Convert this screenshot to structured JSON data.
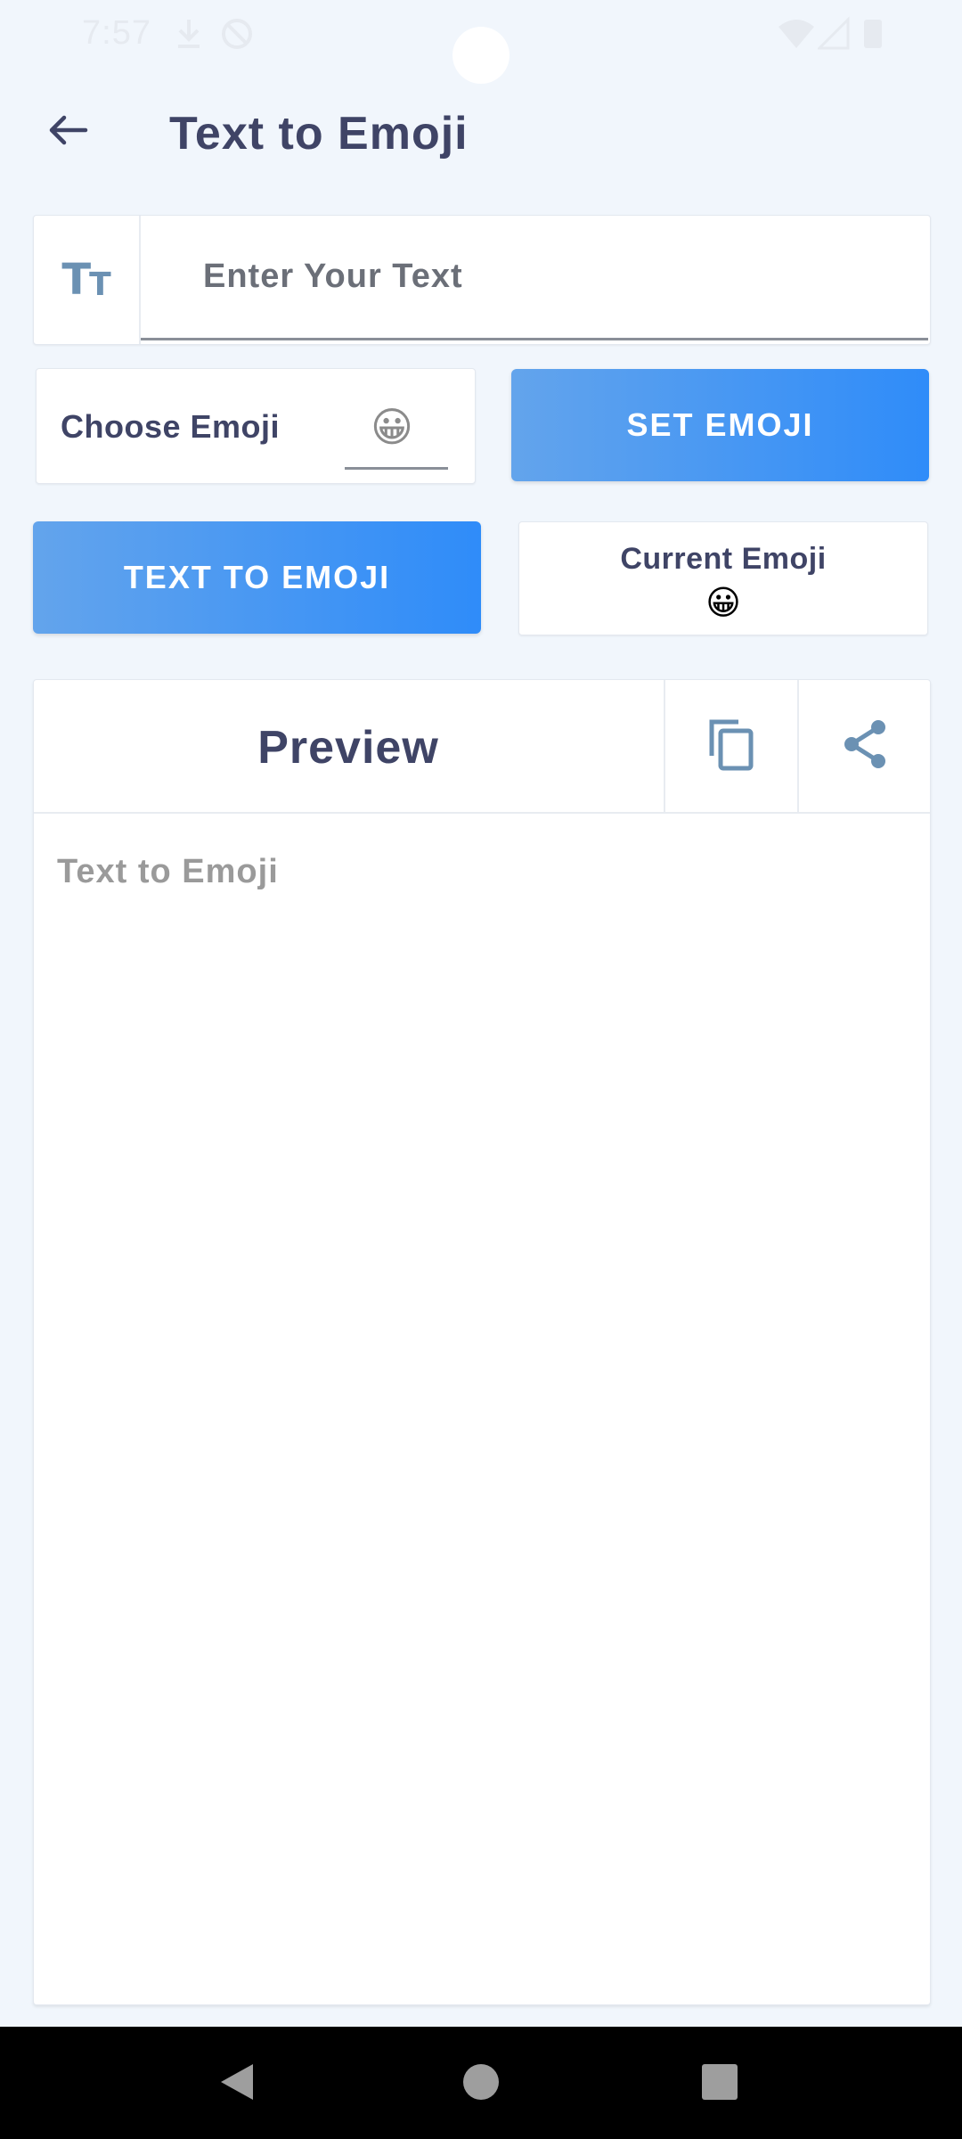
{
  "status_bar": {
    "time": "7:57"
  },
  "header": {
    "title": "Text to Emoji",
    "back_icon": "arrow-left-icon"
  },
  "text_input": {
    "icon": "text-size-icon",
    "icon_big": "T",
    "icon_small": "T",
    "placeholder": "Enter Your Text",
    "value": ""
  },
  "choose_emoji": {
    "label": "Choose Emoji",
    "emoji": "😀"
  },
  "set_emoji_button": "SET EMOJI",
  "text_to_emoji_button": "TEXT TO EMOJI",
  "current_emoji": {
    "label": "Current Emoji",
    "emoji": "😀"
  },
  "preview": {
    "title": "Preview",
    "text": "Text to Emoji",
    "copy_icon": "copy-icon",
    "share_icon": "share-icon"
  },
  "colors": {
    "background": "#f1f6fc",
    "title_text": "#3f4466",
    "accent_gradient_start": "#63a4ec",
    "accent_gradient_end": "#2f8cf9",
    "icon_blue": "#6b91b3"
  }
}
